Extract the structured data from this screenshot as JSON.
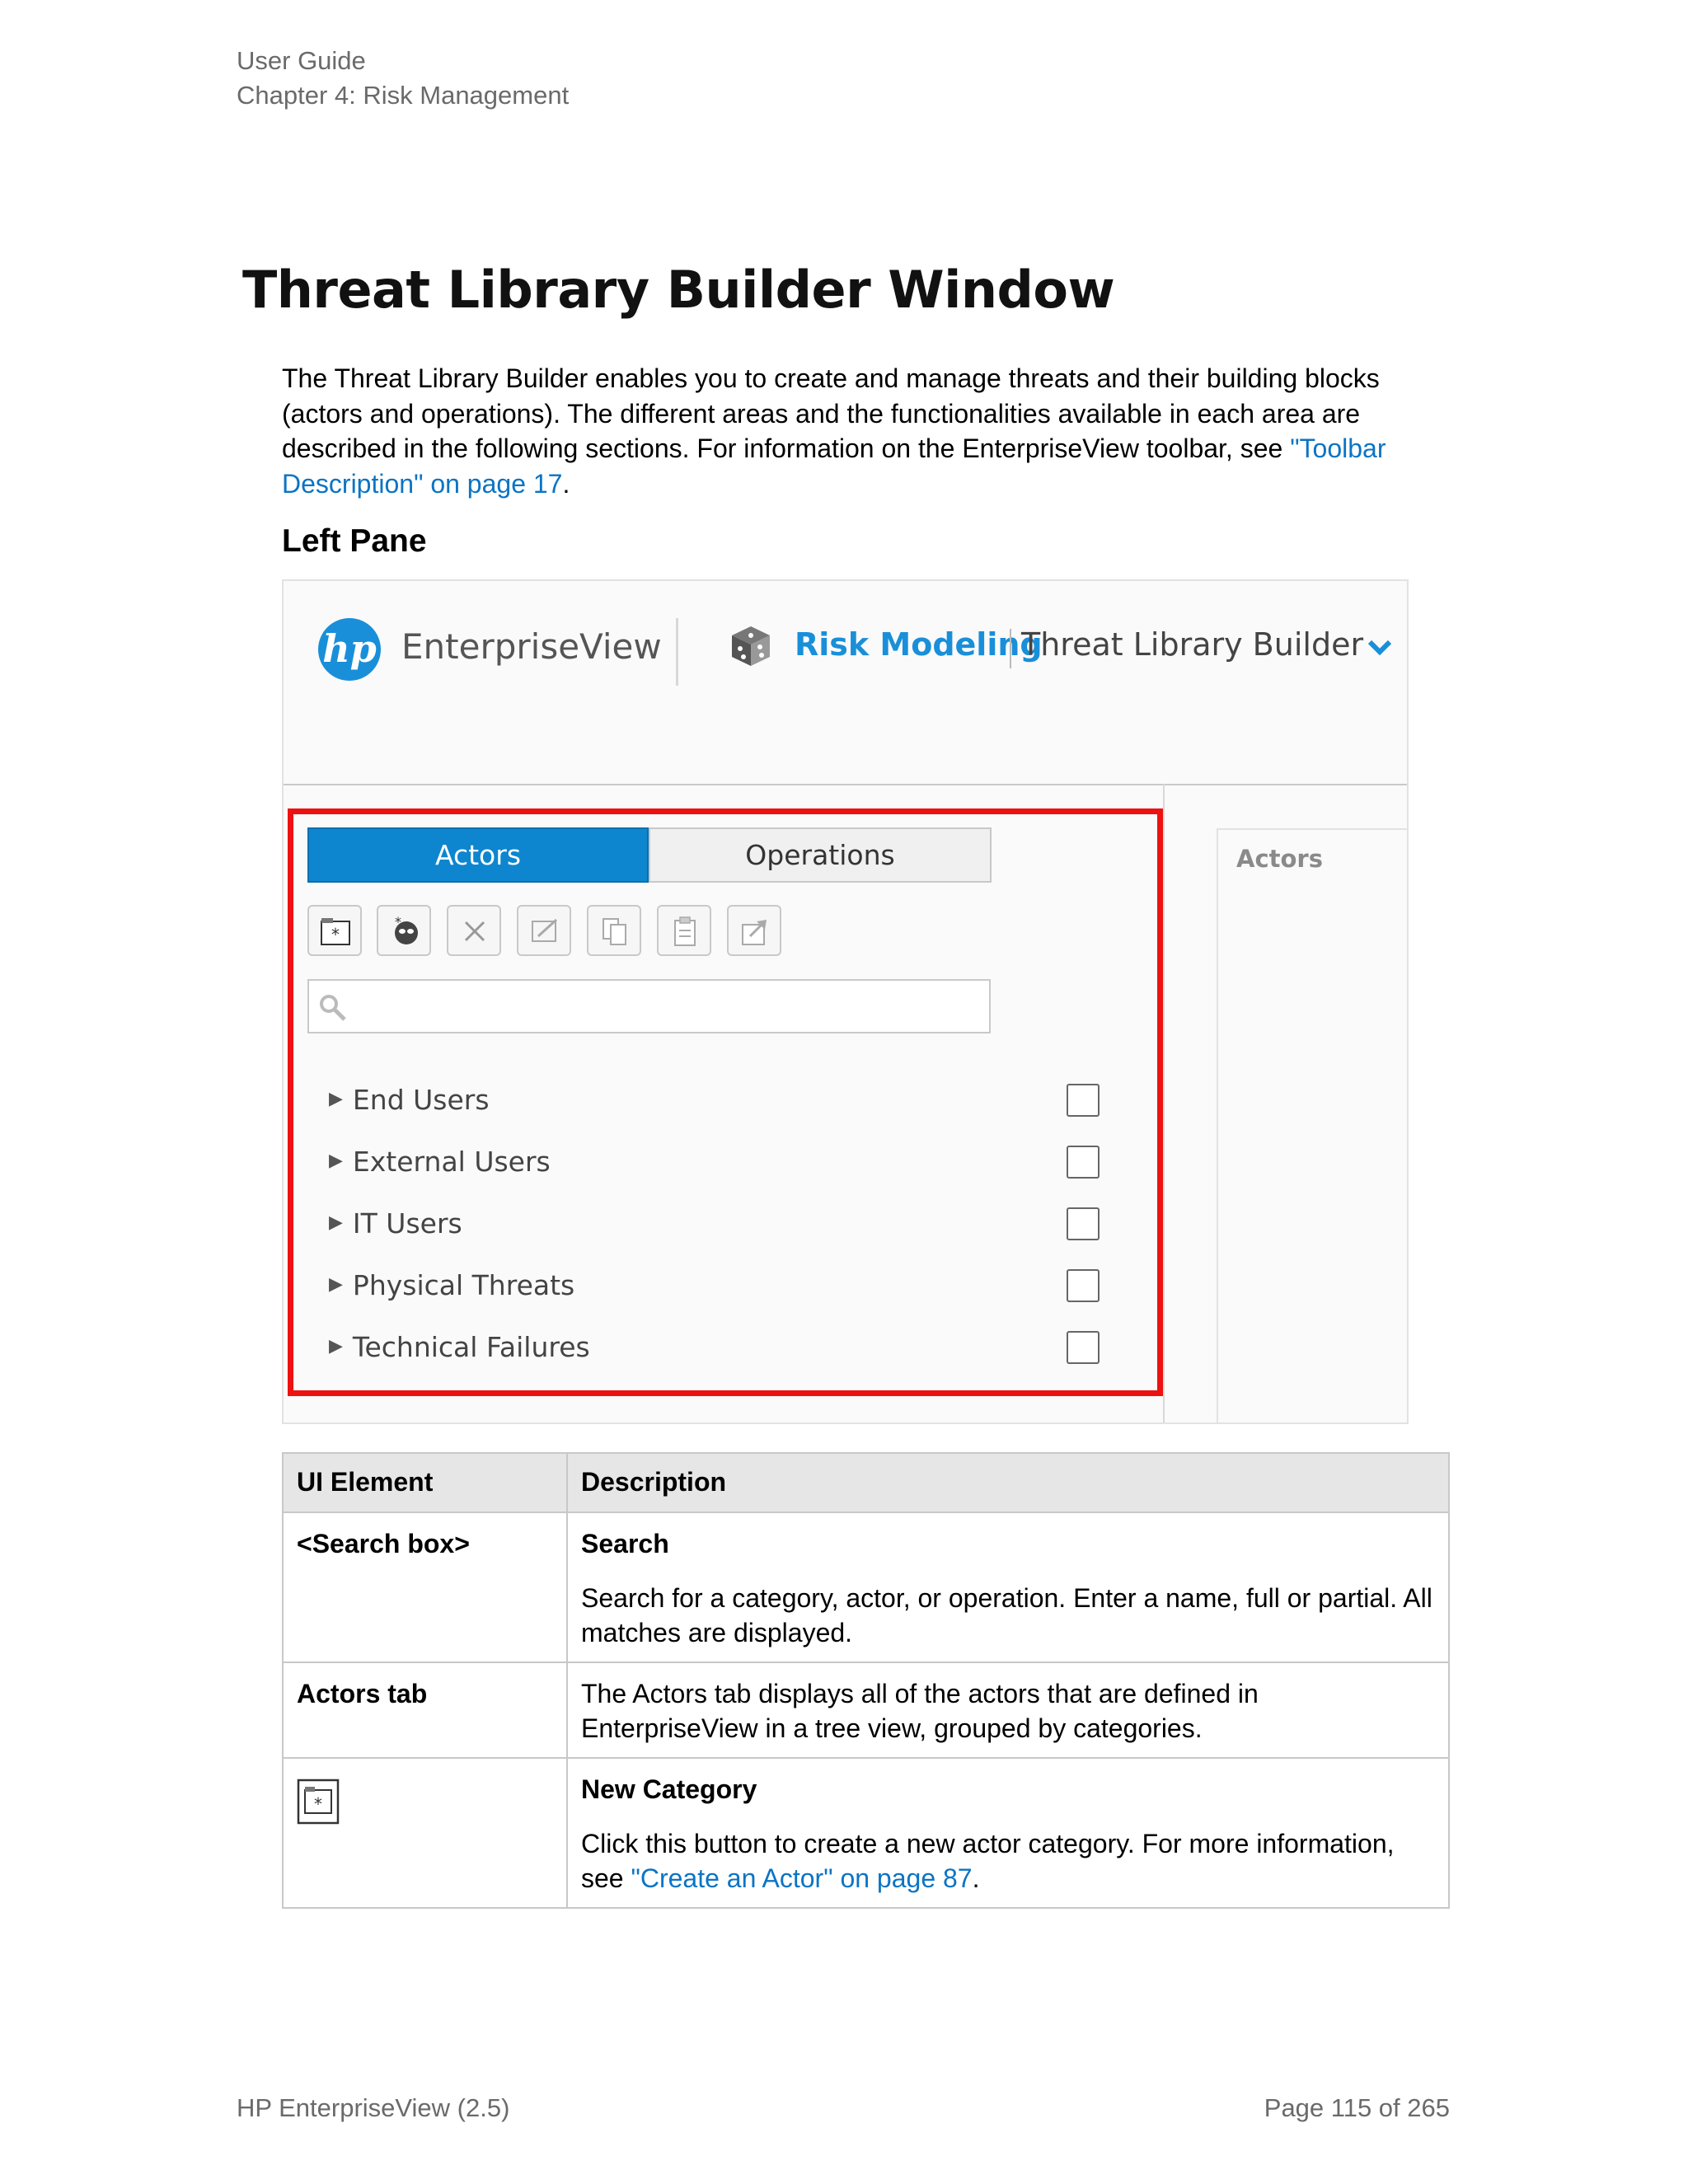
{
  "header": {
    "line1": "User Guide",
    "line2": "Chapter 4: Risk Management"
  },
  "title": "Threat Library Builder Window",
  "intro": {
    "text": "The Threat Library Builder enables you to create and manage threats and their building blocks (actors and operations). The different areas and the functionalities available in each area are described in the following sections. For information on the EnterpriseView toolbar, see ",
    "link": "\"Toolbar Description\" on page 17",
    "end": "."
  },
  "section_heading": "Left Pane",
  "screenshot": {
    "logo_text": "hp",
    "brand": "EnterpriseView",
    "module": "Risk Modeling",
    "page": "Threat Library Builder",
    "right_panel_label": "Actors",
    "tabs": [
      "Actors",
      "Operations"
    ],
    "toolbar_icons": [
      "new-category-icon",
      "new-actor-icon",
      "delete-icon",
      "edit-icon",
      "copy-icon",
      "paste-icon",
      "move-icon"
    ],
    "tree_items": [
      "End Users",
      "External Users",
      "IT Users",
      "Physical Threats",
      "Technical Failures"
    ],
    "accent": "#0d86cf",
    "highlight": "#ee1111"
  },
  "table": {
    "headers": [
      "UI Element",
      "Description"
    ],
    "rows": [
      {
        "element": "<Search box>",
        "title": "Search",
        "desc": "Search for a category, actor, or operation. Enter a name, full or partial. All matches are displayed."
      },
      {
        "element": "Actors tab",
        "desc": "The Actors tab displays all of the actors that are defined in EnterpriseView in a tree view, grouped by categories."
      },
      {
        "element_icon": "new-category-icon",
        "title": "New Category",
        "desc": "Click this button to create a new actor category. For more information, see ",
        "link": "\"Create an Actor\" on page 87",
        "end": "."
      }
    ]
  },
  "footer": {
    "left": "HP EnterpriseView (2.5)",
    "right": "Page 115 of 265"
  }
}
